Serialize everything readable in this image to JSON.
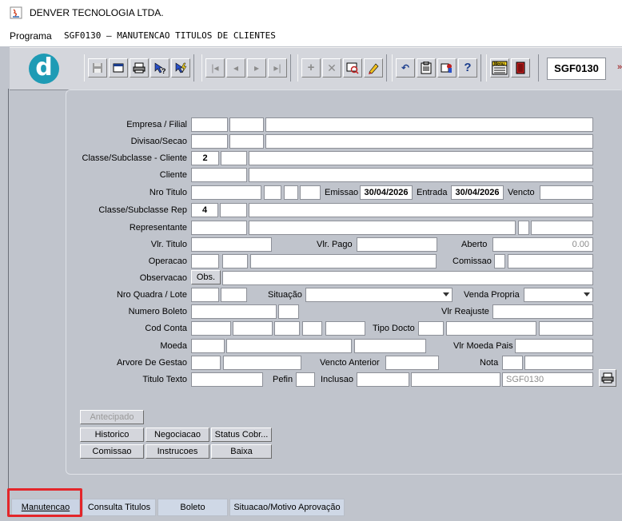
{
  "window": {
    "title": "DENVER TECNOLOGIA LTDA."
  },
  "program": {
    "label": "Programa",
    "value": "SGF0130 – MANUTENCAO TITULOS DE CLIENTES"
  },
  "toolbar": {
    "program_code": "SGF0130",
    "icons": [
      "save-icon",
      "window-icon",
      "print-icon",
      "help-pointer-icon",
      "flash-icon",
      "first-record-icon",
      "previous-record-icon",
      "next-record-icon",
      "last-record-icon",
      "insert-record-icon",
      "delete-record-icon",
      "query-icon",
      "edit-icon",
      "undo-icon",
      "clipboard-icon",
      "user-key-icon",
      "help-icon",
      "menu-icon",
      "exit-icon"
    ],
    "menu_icon_text": "Menu"
  },
  "form": {
    "empresa_filial": {
      "label": "Empresa / Filial"
    },
    "divisao_secao": {
      "label": "Divisao/Secao"
    },
    "classe_cliente": {
      "label": "Classe/Subclasse - Cliente",
      "value": "2"
    },
    "cliente": {
      "label": "Cliente"
    },
    "nro_titulo": {
      "label": "Nro Titulo"
    },
    "emissao": {
      "label": "Emissao",
      "value": "30/04/2026"
    },
    "entrada": {
      "label": "Entrada",
      "value": "30/04/2026"
    },
    "vencto": {
      "label": "Vencto"
    },
    "classe_rep": {
      "label": "Classe/Subclasse Rep",
      "value": "4"
    },
    "representante": {
      "label": "Representante"
    },
    "vlr_titulo": {
      "label": "Vlr. Titulo"
    },
    "vlr_pago": {
      "label": "Vlr. Pago"
    },
    "aberto": {
      "label": "Aberto",
      "value": "0.00"
    },
    "operacao": {
      "label": "Operacao"
    },
    "comissao": {
      "label": "Comissao"
    },
    "observacao": {
      "label": "Observacao",
      "button": "Obs."
    },
    "nro_quadra": {
      "label": "Nro Quadra / Lote"
    },
    "situacao": {
      "label": "Situação"
    },
    "venda_propria": {
      "label": "Venda Propria"
    },
    "numero_boleto": {
      "label": "Numero Boleto"
    },
    "vlr_reajuste": {
      "label": "Vlr Reajuste"
    },
    "cod_conta": {
      "label": "Cod Conta"
    },
    "tipo_docto": {
      "label": "Tipo Docto"
    },
    "moeda": {
      "label": "Moeda"
    },
    "vlr_moeda_pais": {
      "label": "Vlr Moeda Pais"
    },
    "arvore_gestao": {
      "label": "Arvore De Gestao"
    },
    "vencto_anterior": {
      "label": "Vencto Anterior"
    },
    "nota": {
      "label": "Nota"
    },
    "titulo_texto": {
      "label": "Titulo Texto"
    },
    "pefin": {
      "label": "Pefin"
    },
    "inclusao": {
      "label": "Inclusao",
      "value": "SGF0130"
    }
  },
  "buttons": {
    "antecipado": "Antecipado",
    "historico": "Historico",
    "negociacao": "Negociacao",
    "status_cobr": "Status Cobr...",
    "comissao": "Comissao",
    "instrucoes": "Instrucoes",
    "baixa": "Baixa"
  },
  "tabs": [
    {
      "label": "Manutencao",
      "active": true
    },
    {
      "label": "Consulta Titulos"
    },
    {
      "label": "Boleto"
    },
    {
      "label": "Situacao/Motivo Aprovação"
    }
  ],
  "colors": {
    "accent": "#1e9bb5",
    "highlight": "#e3262a"
  }
}
